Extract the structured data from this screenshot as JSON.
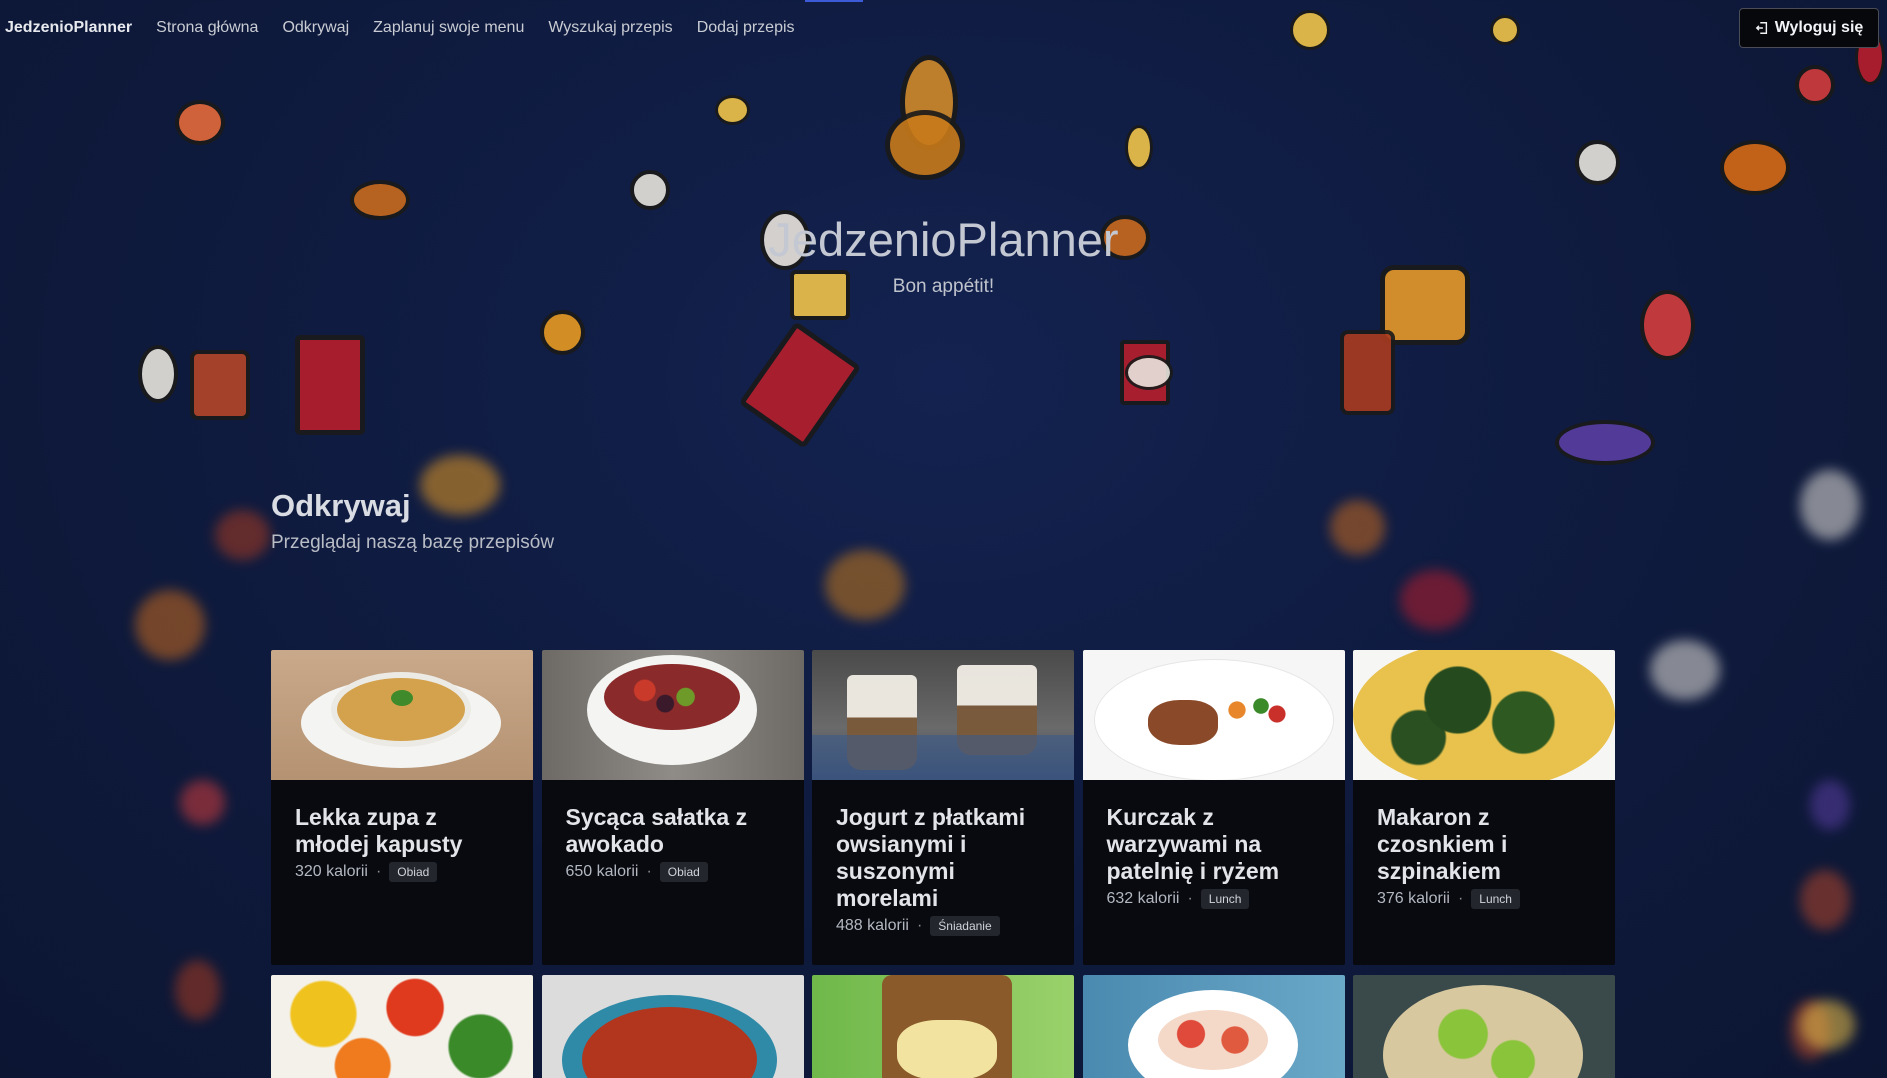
{
  "nav": {
    "brand": "JedzenioPlanner",
    "links": [
      "Strona główna",
      "Odkrywaj",
      "Zaplanuj swoje menu",
      "Wyszukaj przepis",
      "Dodaj przepis"
    ],
    "logout_label": "Wyloguj się"
  },
  "hero": {
    "title": "JedzenioPlanner",
    "subtitle": "Bon appétit!"
  },
  "section": {
    "title": "Odkrywaj",
    "subtitle": "Przeglądaj naszą bazę przepisów"
  },
  "recipes": [
    {
      "title": "Lekka zupa z młodej kapusty",
      "calories": "320 kalorii",
      "tag": "Obiad"
    },
    {
      "title": "Sycąca sałatka z awokado",
      "calories": "650 kalorii",
      "tag": "Obiad"
    },
    {
      "title": "Jogurt z płatkami owsianymi i suszonymi morelami",
      "calories": "488 kalorii",
      "tag": "Śniadanie"
    },
    {
      "title": "Kurczak z warzywami na patelnię i ryżem",
      "calories": "632 kalorii",
      "tag": "Lunch"
    },
    {
      "title": "Makaron z czosnkiem i szpinakiem",
      "calories": "376 kalorii",
      "tag": "Lunch"
    }
  ],
  "colors": {
    "background": "#0f1b40",
    "card": "#080a10",
    "accent": "#3d5bd8"
  }
}
